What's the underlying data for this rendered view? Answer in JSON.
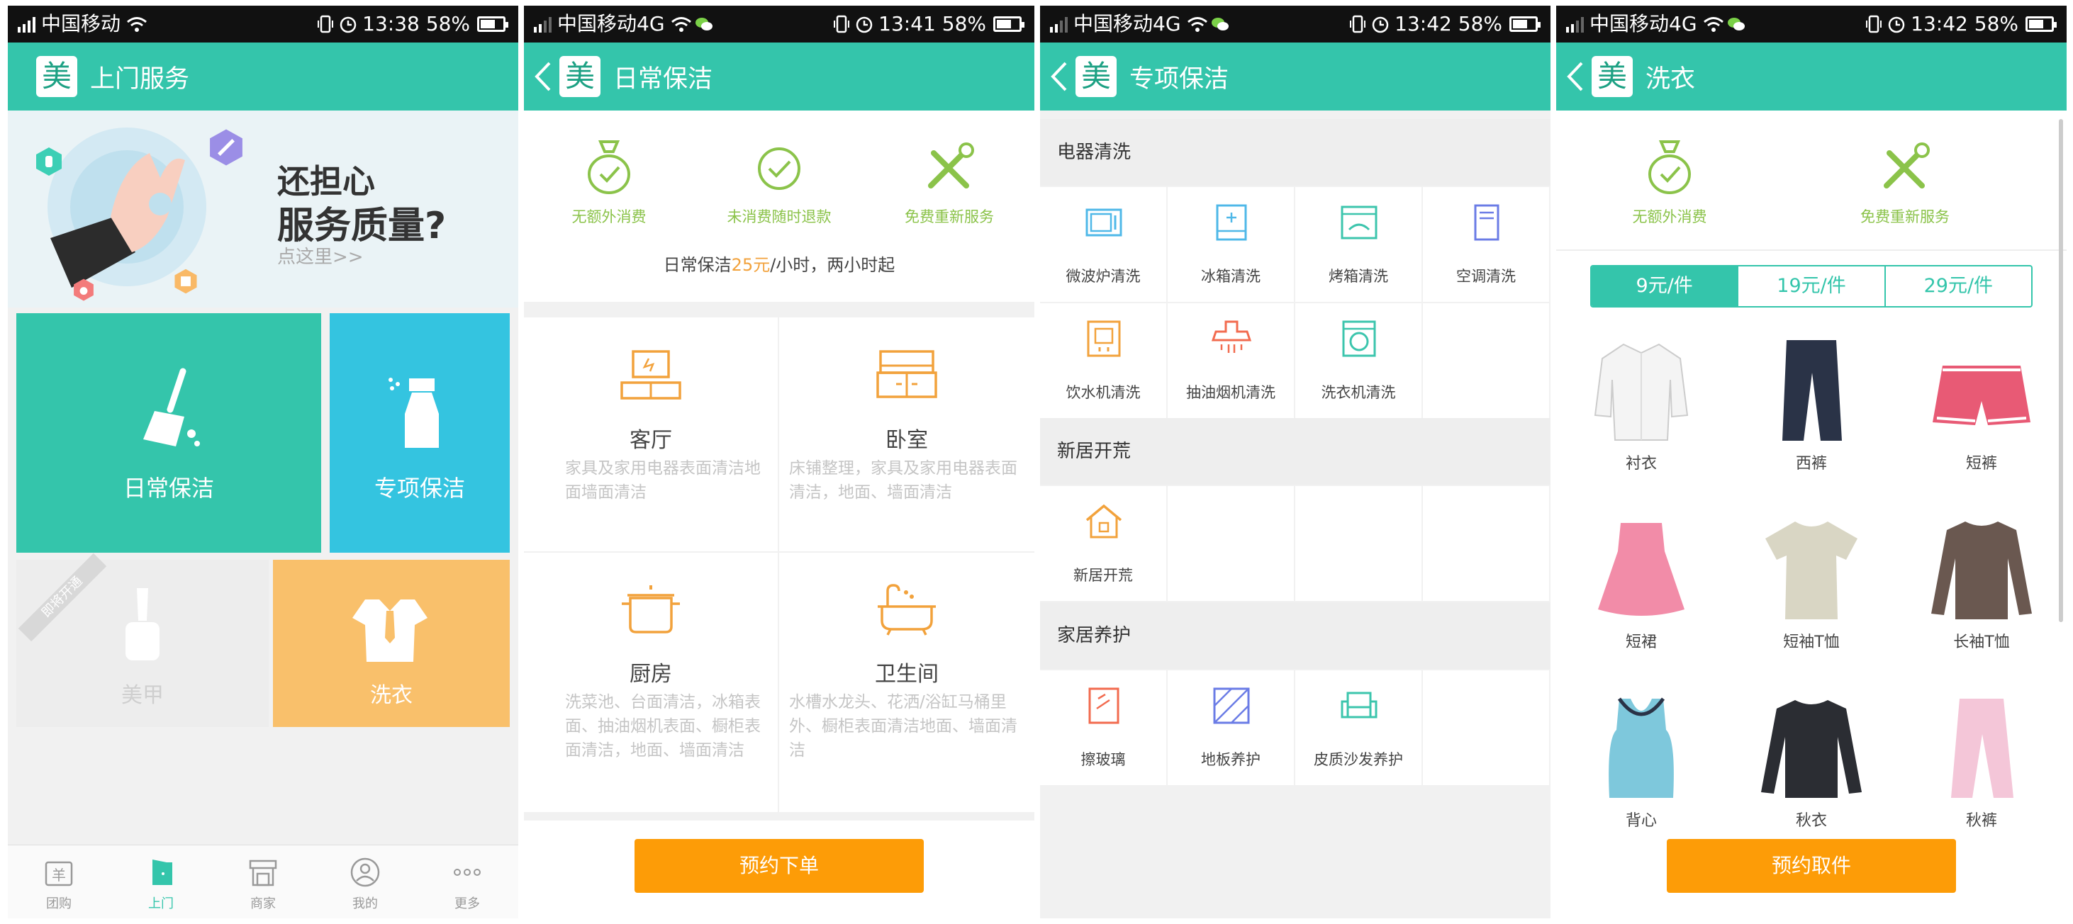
{
  "screens": [
    {
      "status": {
        "carrier": "中国移动",
        "time": "13:38",
        "battery": "58%"
      },
      "title": "上门服务",
      "logo": "美",
      "banner": {
        "line1": "还担心",
        "line2": "服务质量?",
        "link": "点这里>>"
      },
      "tiles": {
        "daily": "日常保洁",
        "special": "专项保洁",
        "nail": "美甲",
        "nail_ribbon": "即将开通",
        "laundry": "洗衣"
      },
      "tabs": [
        "团购",
        "上门",
        "商家",
        "我的",
        "更多"
      ],
      "active_tab": "上门"
    },
    {
      "status": {
        "carrier": "中国移动4G",
        "time": "13:41",
        "battery": "58%"
      },
      "title": "日常保洁",
      "logo": "美",
      "promos": [
        "无额外消费",
        "未消费随时退款",
        "免费重新服务"
      ],
      "price_note": {
        "prefix": "日常保洁",
        "price": "25元",
        "suffix": "/小时，两小时起"
      },
      "rooms": [
        {
          "title": "客厅",
          "desc": "家具及家用电器表面清洁地面墙面清洁"
        },
        {
          "title": "卧室",
          "desc": "床铺整理，家具及家用电器表面清洁，地面、墙面清洁"
        },
        {
          "title": "厨房",
          "desc": "洗菜池、台面清洁，冰箱表面、抽油烟机表面、橱柜表面清洁，地面、墙面清洁"
        },
        {
          "title": "卫生间",
          "desc": "水槽水龙头、花洒/浴缸马桶里外、橱柜表面清洁地面、墙面清洁"
        }
      ],
      "order_button": "预约下单"
    },
    {
      "status": {
        "carrier": "中国移动4G",
        "time": "13:42",
        "battery": "58%"
      },
      "title": "专项保洁",
      "logo": "美",
      "sections": [
        {
          "title": "电器清洗",
          "items": [
            "微波炉清洗",
            "冰箱清洗",
            "烤箱清洗",
            "空调清洗",
            "饮水机清洗",
            "抽油烟机清洗",
            "洗衣机清洗"
          ]
        },
        {
          "title": "新居开荒",
          "items": [
            "新居开荒"
          ]
        },
        {
          "title": "家居养护",
          "items": [
            "擦玻璃",
            "地板养护",
            "皮质沙发养护"
          ]
        }
      ]
    },
    {
      "status": {
        "carrier": "中国移动4G",
        "time": "13:42",
        "battery": "58%"
      },
      "title": "洗衣",
      "logo": "美",
      "promos": [
        "无额外消费",
        "免费重新服务"
      ],
      "price_tabs": [
        "9元/件",
        "19元/件",
        "29元/件"
      ],
      "selected_price": "9元/件",
      "clothes": [
        "衬衣",
        "西裤",
        "短裤",
        "短裙",
        "短袖T恤",
        "长袖T恤",
        "背心",
        "秋衣",
        "秋裤"
      ],
      "pickup_button": "预约取件"
    }
  ],
  "colors": {
    "teal": "#34c5ab",
    "cyan": "#34c4e0",
    "orange": "#fd9c07",
    "peach": "#f9c06b",
    "green": "#8bc34a"
  }
}
